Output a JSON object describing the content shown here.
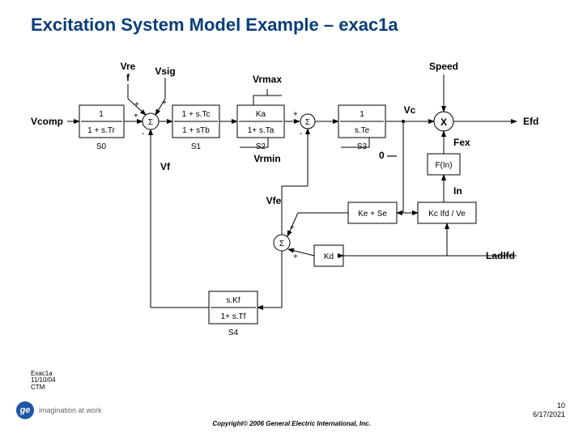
{
  "slide": {
    "title": "Excitation System Model Example – exac1a",
    "copyright": "Copyright© 2006 General Electric International, Inc.",
    "page_number": "10",
    "date": "6/17/2021",
    "logo_tag": "imagination at work",
    "notes_line1": "Exac1a",
    "notes_line2": "11/10/04",
    "notes_line3": "CTM"
  },
  "diagram": {
    "signals": {
      "vref": "Vre\nf",
      "vsig": "Vsig",
      "vcomp": "Vcomp",
      "vrmax": "Vrmax",
      "vrmin": "Vrmin",
      "vf": "Vf",
      "vfe": "Vfe",
      "speed": "Speed",
      "vc": "Vc",
      "efd": "Efd",
      "fex": "Fex",
      "in": "In",
      "ladifd": "LadIfd",
      "zero": "0",
      "kd": "Kd"
    },
    "blocks": {
      "b0": {
        "top": "1",
        "bot": "1 + s.Tr",
        "tag": "S0"
      },
      "b1": {
        "top": "1 + s.Tc",
        "bot": "1 + sTb",
        "tag": "S1"
      },
      "b2": {
        "top": "Ka",
        "bot": "1+ s.Ta",
        "tag": "S2"
      },
      "b3": {
        "top": "1",
        "bot": "s.Te",
        "tag": "S3"
      },
      "fin": "F(In)",
      "kese": "Ke + Se",
      "kcifd": "Kc Ifd / Ve",
      "b4": {
        "top": "s.Kf",
        "bot": "1+ s.Tf",
        "tag": "S4"
      }
    },
    "sum": "Σ",
    "mult": "X"
  }
}
